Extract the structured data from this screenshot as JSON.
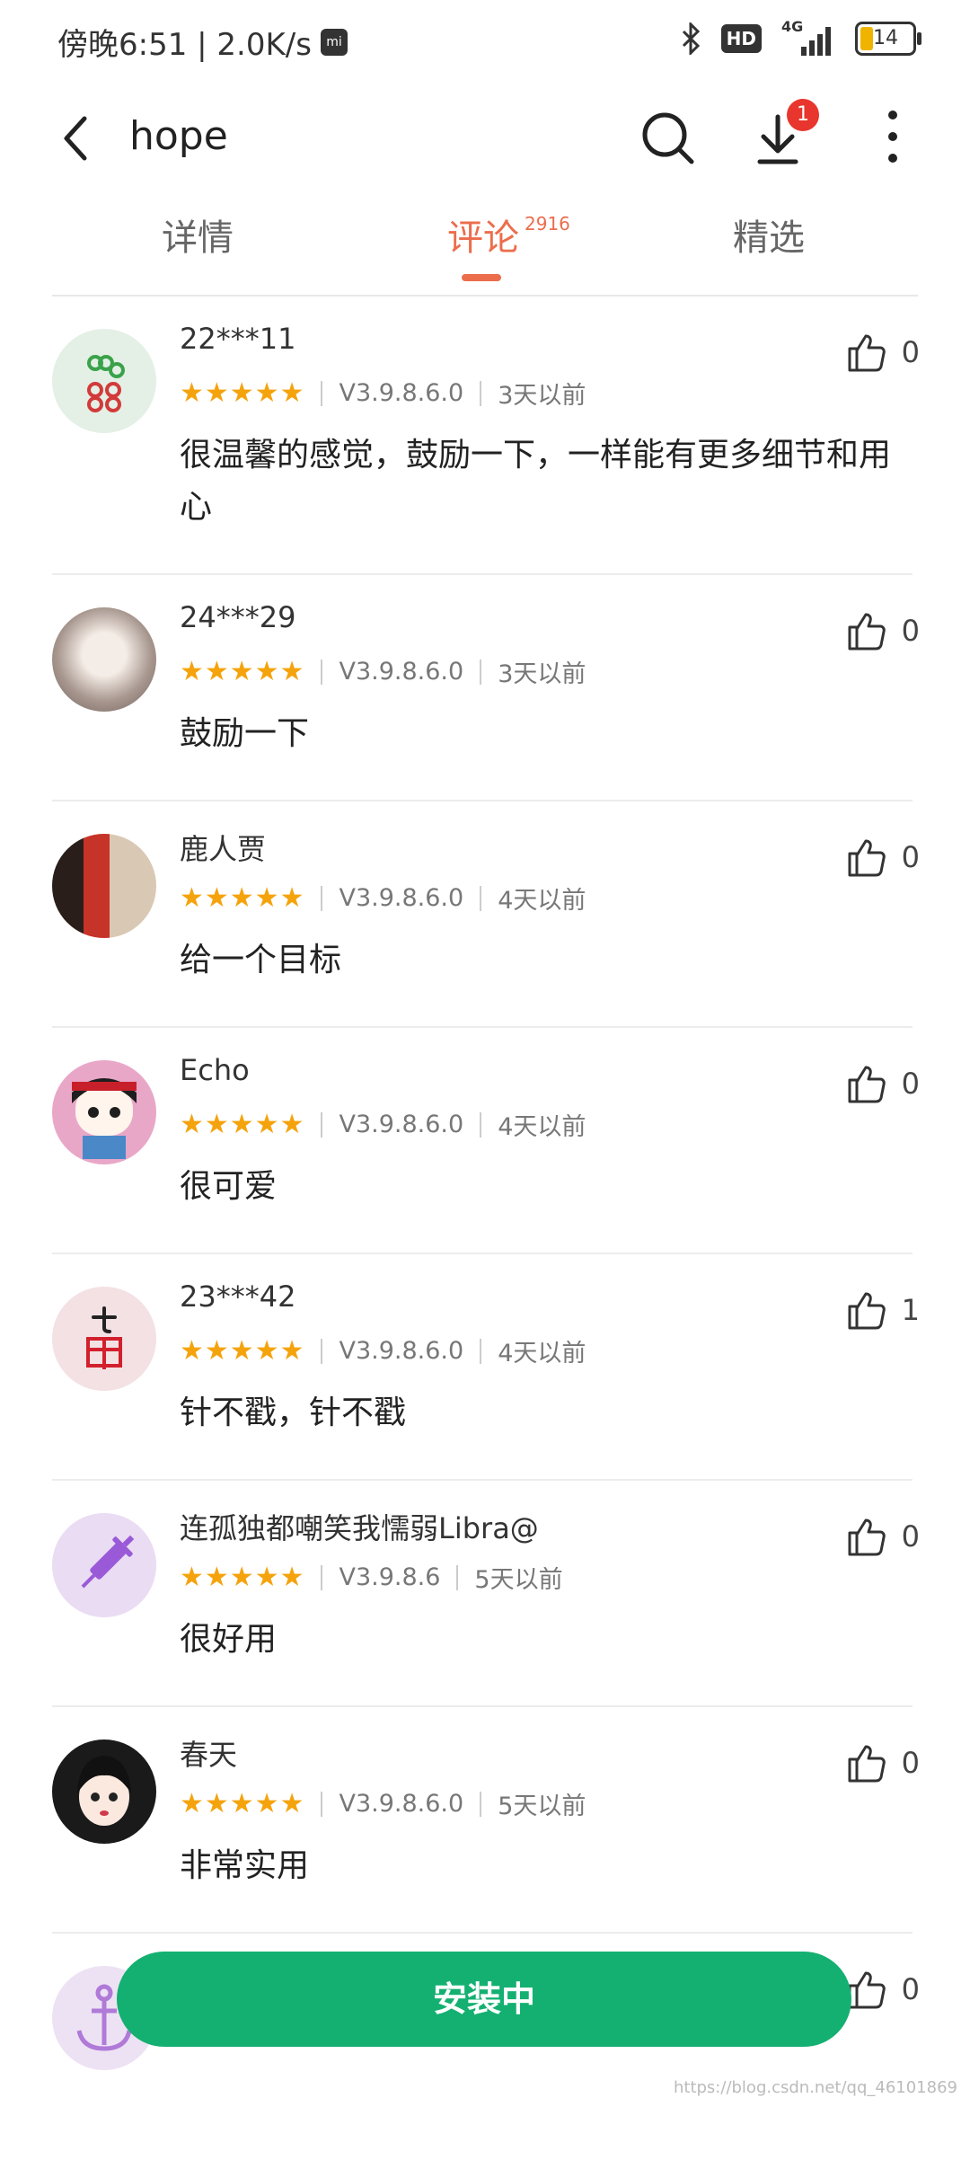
{
  "status_bar": {
    "time_speed": "傍晚6:51 | 2.0K/s",
    "network": "4G",
    "hd": "HD",
    "battery": "14"
  },
  "toolbar": {
    "title": "hope",
    "download_badge": "1"
  },
  "tabs": [
    {
      "label": "详情"
    },
    {
      "label": "评论",
      "count": "2916"
    },
    {
      "label": "精选"
    }
  ],
  "reviews": [
    {
      "user": "22***11",
      "stars": "★★★★★",
      "version": "V3.9.8.6.0",
      "time": "3天以前",
      "text": "很温馨的感觉，鼓励一下，一样能有更多细节和用心",
      "likes": "0"
    },
    {
      "user": "24***29",
      "stars": "★★★★★",
      "version": "V3.9.8.6.0",
      "time": "3天以前",
      "text": "鼓励一下",
      "likes": "0"
    },
    {
      "user": "鹿人贾",
      "stars": "★★★★★",
      "version": "V3.9.8.6.0",
      "time": "4天以前",
      "text": "给一个目标",
      "likes": "0"
    },
    {
      "user": "Echo",
      "stars": "★★★★★",
      "version": "V3.9.8.6.0",
      "time": "4天以前",
      "text": "很可爱",
      "likes": "0"
    },
    {
      "user": "23***42",
      "stars": "★★★★★",
      "version": "V3.9.8.6.0",
      "time": "4天以前",
      "text": "针不戳，针不戳",
      "likes": "1"
    },
    {
      "user": "连孤独都嘲笑我懦弱Libra@",
      "stars": "★★★★★",
      "version": "V3.9.8.6",
      "time": "5天以前",
      "text": "很好用",
      "likes": "0"
    },
    {
      "user": "春天",
      "stars": "★★★★★",
      "version": "V3.9.8.6.0",
      "time": "5天以前",
      "text": "非常实用",
      "likes": "0"
    },
    {
      "user": "",
      "stars": "★★★★★",
      "version": "",
      "time": "",
      "text": "",
      "likes": "0"
    }
  ],
  "install_button": "安装中",
  "watermark": "https://blog.csdn.net/qq_46101869",
  "colors": {
    "accent": "#ec6d4c",
    "install": "#14b071",
    "star": "#f5a30c"
  }
}
